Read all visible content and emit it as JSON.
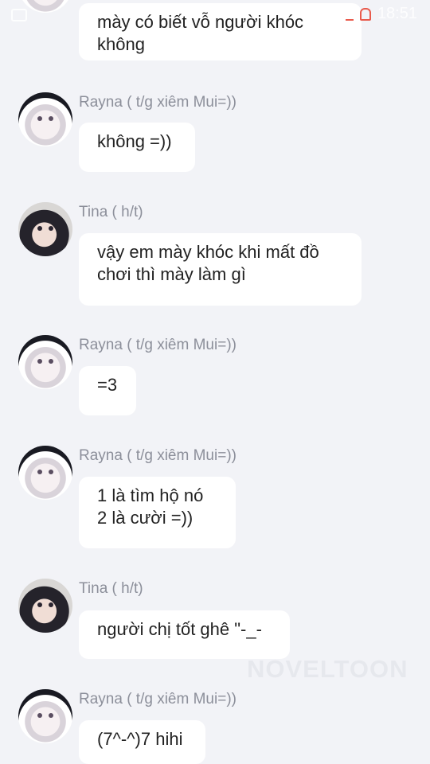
{
  "status_bar": {
    "time": "18:51"
  },
  "messages": [
    {
      "sender": "",
      "text": "mày có biết vỗ người khóc\nkhông"
    },
    {
      "sender": "Rayna ( t/g xiêm Mui=))",
      "text": "không =))"
    },
    {
      "sender": "Tina ( h/t)",
      "text": "vậy em mày khóc khi mất đồ\nchơi thì mày làm gì"
    },
    {
      "sender": "Rayna ( t/g xiêm Mui=))",
      "text": "=3"
    },
    {
      "sender": "Rayna ( t/g xiêm Mui=))",
      "text": "1 là tìm hộ nó\n2 là cười =))"
    },
    {
      "sender": "Tina ( h/t)",
      "text": "người chị tốt ghê \"-_-"
    },
    {
      "sender": "Rayna ( t/g xiêm Mui=))",
      "text": "(7^-^)7 hihi"
    }
  ],
  "watermark": "NOVELTOON"
}
